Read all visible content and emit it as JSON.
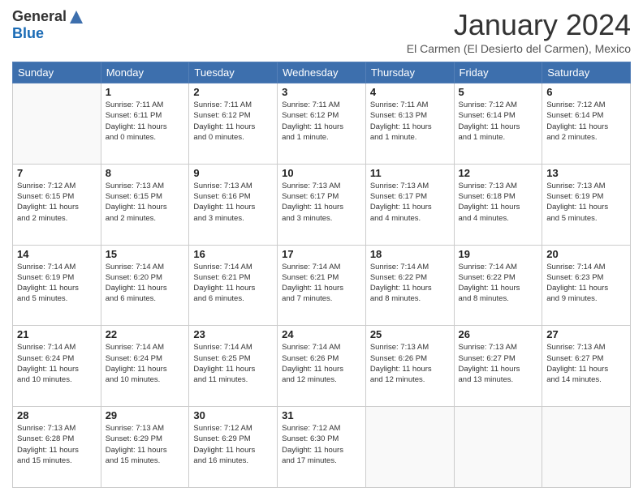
{
  "header": {
    "logo_general": "General",
    "logo_blue": "Blue",
    "month_title": "January 2024",
    "subtitle": "El Carmen (El Desierto del Carmen), Mexico"
  },
  "days_of_week": [
    "Sunday",
    "Monday",
    "Tuesday",
    "Wednesday",
    "Thursday",
    "Friday",
    "Saturday"
  ],
  "weeks": [
    [
      {
        "day": "",
        "info": ""
      },
      {
        "day": "1",
        "info": "Sunrise: 7:11 AM\nSunset: 6:11 PM\nDaylight: 11 hours\nand 0 minutes."
      },
      {
        "day": "2",
        "info": "Sunrise: 7:11 AM\nSunset: 6:12 PM\nDaylight: 11 hours\nand 0 minutes."
      },
      {
        "day": "3",
        "info": "Sunrise: 7:11 AM\nSunset: 6:12 PM\nDaylight: 11 hours\nand 1 minute."
      },
      {
        "day": "4",
        "info": "Sunrise: 7:11 AM\nSunset: 6:13 PM\nDaylight: 11 hours\nand 1 minute."
      },
      {
        "day": "5",
        "info": "Sunrise: 7:12 AM\nSunset: 6:14 PM\nDaylight: 11 hours\nand 1 minute."
      },
      {
        "day": "6",
        "info": "Sunrise: 7:12 AM\nSunset: 6:14 PM\nDaylight: 11 hours\nand 2 minutes."
      }
    ],
    [
      {
        "day": "7",
        "info": "Sunrise: 7:12 AM\nSunset: 6:15 PM\nDaylight: 11 hours\nand 2 minutes."
      },
      {
        "day": "8",
        "info": "Sunrise: 7:13 AM\nSunset: 6:15 PM\nDaylight: 11 hours\nand 2 minutes."
      },
      {
        "day": "9",
        "info": "Sunrise: 7:13 AM\nSunset: 6:16 PM\nDaylight: 11 hours\nand 3 minutes."
      },
      {
        "day": "10",
        "info": "Sunrise: 7:13 AM\nSunset: 6:17 PM\nDaylight: 11 hours\nand 3 minutes."
      },
      {
        "day": "11",
        "info": "Sunrise: 7:13 AM\nSunset: 6:17 PM\nDaylight: 11 hours\nand 4 minutes."
      },
      {
        "day": "12",
        "info": "Sunrise: 7:13 AM\nSunset: 6:18 PM\nDaylight: 11 hours\nand 4 minutes."
      },
      {
        "day": "13",
        "info": "Sunrise: 7:13 AM\nSunset: 6:19 PM\nDaylight: 11 hours\nand 5 minutes."
      }
    ],
    [
      {
        "day": "14",
        "info": "Sunrise: 7:14 AM\nSunset: 6:19 PM\nDaylight: 11 hours\nand 5 minutes."
      },
      {
        "day": "15",
        "info": "Sunrise: 7:14 AM\nSunset: 6:20 PM\nDaylight: 11 hours\nand 6 minutes."
      },
      {
        "day": "16",
        "info": "Sunrise: 7:14 AM\nSunset: 6:21 PM\nDaylight: 11 hours\nand 6 minutes."
      },
      {
        "day": "17",
        "info": "Sunrise: 7:14 AM\nSunset: 6:21 PM\nDaylight: 11 hours\nand 7 minutes."
      },
      {
        "day": "18",
        "info": "Sunrise: 7:14 AM\nSunset: 6:22 PM\nDaylight: 11 hours\nand 8 minutes."
      },
      {
        "day": "19",
        "info": "Sunrise: 7:14 AM\nSunset: 6:22 PM\nDaylight: 11 hours\nand 8 minutes."
      },
      {
        "day": "20",
        "info": "Sunrise: 7:14 AM\nSunset: 6:23 PM\nDaylight: 11 hours\nand 9 minutes."
      }
    ],
    [
      {
        "day": "21",
        "info": "Sunrise: 7:14 AM\nSunset: 6:24 PM\nDaylight: 11 hours\nand 10 minutes."
      },
      {
        "day": "22",
        "info": "Sunrise: 7:14 AM\nSunset: 6:24 PM\nDaylight: 11 hours\nand 10 minutes."
      },
      {
        "day": "23",
        "info": "Sunrise: 7:14 AM\nSunset: 6:25 PM\nDaylight: 11 hours\nand 11 minutes."
      },
      {
        "day": "24",
        "info": "Sunrise: 7:14 AM\nSunset: 6:26 PM\nDaylight: 11 hours\nand 12 minutes."
      },
      {
        "day": "25",
        "info": "Sunrise: 7:13 AM\nSunset: 6:26 PM\nDaylight: 11 hours\nand 12 minutes."
      },
      {
        "day": "26",
        "info": "Sunrise: 7:13 AM\nSunset: 6:27 PM\nDaylight: 11 hours\nand 13 minutes."
      },
      {
        "day": "27",
        "info": "Sunrise: 7:13 AM\nSunset: 6:27 PM\nDaylight: 11 hours\nand 14 minutes."
      }
    ],
    [
      {
        "day": "28",
        "info": "Sunrise: 7:13 AM\nSunset: 6:28 PM\nDaylight: 11 hours\nand 15 minutes."
      },
      {
        "day": "29",
        "info": "Sunrise: 7:13 AM\nSunset: 6:29 PM\nDaylight: 11 hours\nand 15 minutes."
      },
      {
        "day": "30",
        "info": "Sunrise: 7:12 AM\nSunset: 6:29 PM\nDaylight: 11 hours\nand 16 minutes."
      },
      {
        "day": "31",
        "info": "Sunrise: 7:12 AM\nSunset: 6:30 PM\nDaylight: 11 hours\nand 17 minutes."
      },
      {
        "day": "",
        "info": ""
      },
      {
        "day": "",
        "info": ""
      },
      {
        "day": "",
        "info": ""
      }
    ]
  ]
}
